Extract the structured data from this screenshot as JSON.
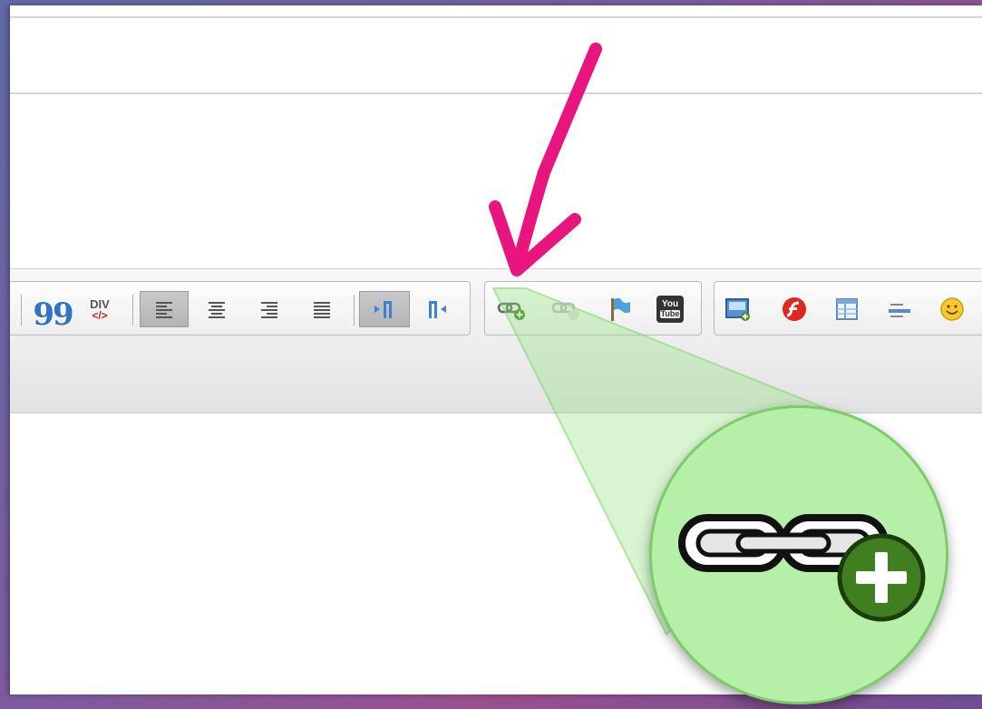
{
  "toolbar": {
    "blockquote": {
      "label": "99",
      "icon": "blockquote-icon"
    },
    "div": {
      "label_top": "DIV",
      "label_bottom": "</>",
      "icon": "div-container-icon"
    },
    "align_left": {
      "icon": "align-left-icon",
      "active": true
    },
    "align_center": {
      "icon": "align-center-icon"
    },
    "align_right": {
      "icon": "align-right-icon"
    },
    "align_justify": {
      "icon": "align-justify-icon"
    },
    "ltr": {
      "icon": "text-direction-ltr-icon",
      "active": true
    },
    "rtl": {
      "icon": "text-direction-rtl-icon"
    },
    "link": {
      "icon": "link-icon"
    },
    "unlink": {
      "icon": "unlink-icon"
    },
    "anchor": {
      "icon": "anchor-flag-icon"
    },
    "youtube": {
      "label_top": "You",
      "label_bottom": "Tube",
      "icon": "youtube-icon"
    },
    "image": {
      "icon": "insert-image-icon"
    },
    "flash": {
      "icon": "flash-icon"
    },
    "table": {
      "icon": "table-icon"
    },
    "hr": {
      "icon": "horizontal-rule-icon"
    },
    "smiley": {
      "icon": "smiley-icon"
    }
  },
  "annotation": {
    "arrow_color": "#e8157f",
    "callout_color": "#7ed66b",
    "zoom_icon": "link-add-icon"
  }
}
